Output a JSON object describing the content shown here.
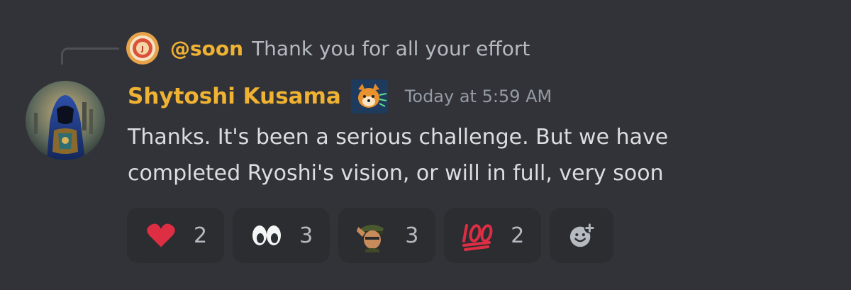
{
  "reply": {
    "username": "@soon",
    "text": "Thank you for all your effort",
    "avatar_icon": "reply-avatar-icon"
  },
  "message": {
    "author": "Shytoshi Kusama",
    "author_color": "#f0b232",
    "badge_icon": "shiba-badge-icon",
    "timestamp": "Today at 5:59 AM",
    "lines": [
      "Thanks. It's been a serious challenge. But we have",
      "completed Ryoshi's vision, or will in full, very soon"
    ]
  },
  "reactions": [
    {
      "icon": "red-heart-icon",
      "count": "2"
    },
    {
      "icon": "eyes-icon",
      "count": "3"
    },
    {
      "icon": "soldier-salute-icon",
      "count": "3"
    },
    {
      "icon": "hundred-points-icon",
      "count": "2"
    }
  ],
  "add_reaction": {
    "icon": "add-reaction-icon"
  }
}
